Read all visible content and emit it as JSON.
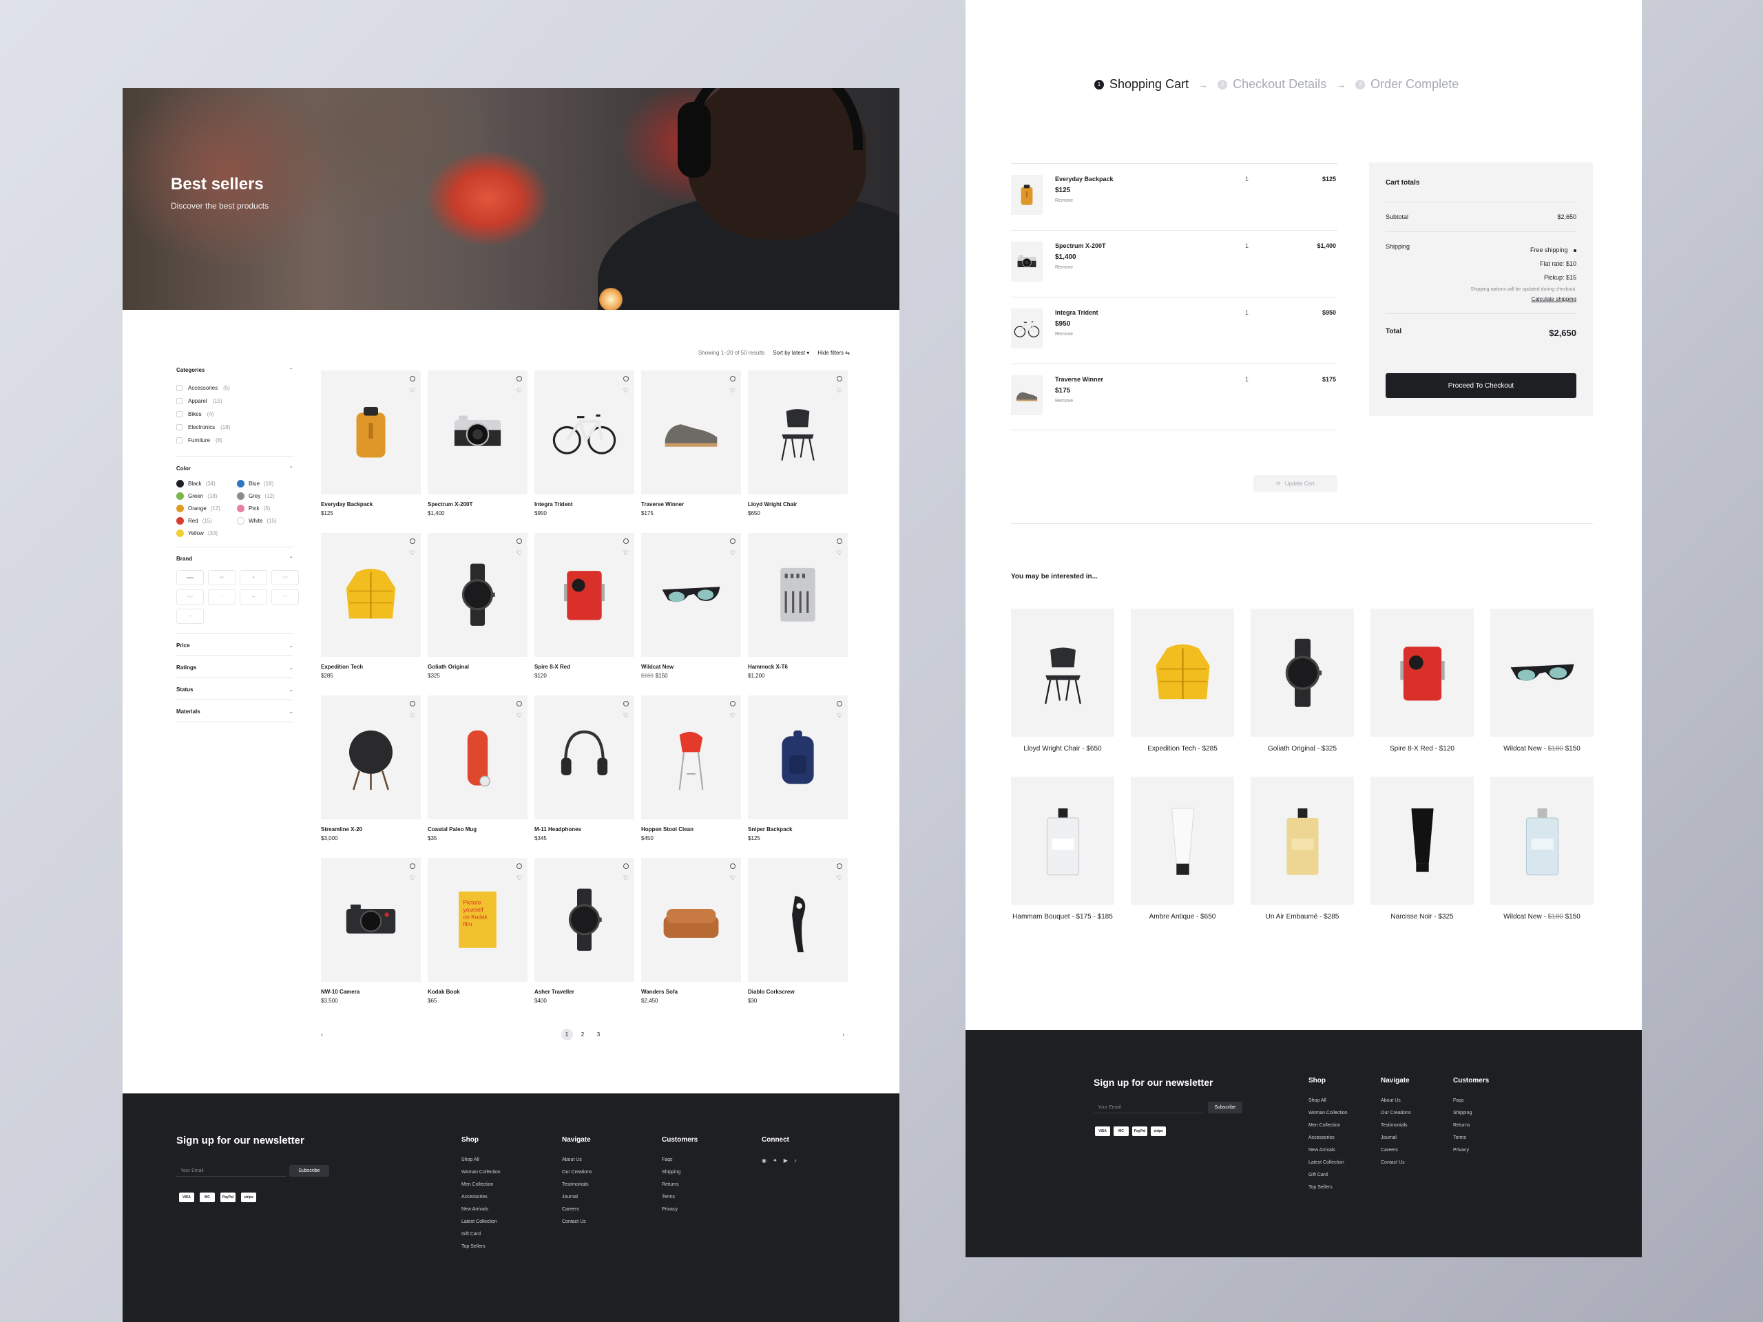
{
  "shop": {
    "hero": {
      "title": "Best sellers",
      "subtitle": "Discover the best products"
    },
    "results": {
      "showing": "Showing 1–20 of 50 results",
      "sort": "Sort by latest",
      "sort_chev": "▾",
      "hide": "Hide filters",
      "hide_icon": "⇆"
    },
    "filters": {
      "categories": {
        "title": "Categories",
        "chev": "⌃",
        "items": [
          {
            "label": "Accessories",
            "count": "(5)"
          },
          {
            "label": "Apparel",
            "count": "(15)"
          },
          {
            "label": "Bikes",
            "count": "(4)"
          },
          {
            "label": "Electronics",
            "count": "(18)"
          },
          {
            "label": "Furniture",
            "count": "(8)"
          }
        ]
      },
      "color": {
        "title": "Color",
        "chev": "⌃",
        "items": [
          {
            "label": "Black",
            "count": "(34)",
            "hex": "#1e1f22"
          },
          {
            "label": "Blue",
            "count": "(18)",
            "hex": "#2f76c4"
          },
          {
            "label": "Green",
            "count": "(18)",
            "hex": "#7ab648"
          },
          {
            "label": "Grey",
            "count": "(12)",
            "hex": "#8a8c92"
          },
          {
            "label": "Orange",
            "count": "(12)",
            "hex": "#e39a24"
          },
          {
            "label": "Pink",
            "count": "(5)",
            "hex": "#e77fa2"
          },
          {
            "label": "Red",
            "count": "(15)",
            "hex": "#d93a32"
          },
          {
            "label": "White",
            "count": "(15)",
            "hex": "#ffffff"
          },
          {
            "label": "Yellow",
            "count": "(33)",
            "hex": "#f2cd33"
          }
        ]
      },
      "brand": {
        "title": "Brand",
        "chev": "⌃"
      },
      "collapsed": [
        {
          "title": "Price",
          "chev": "⌄"
        },
        {
          "title": "Ratings",
          "chev": "⌄"
        },
        {
          "title": "Status",
          "chev": "⌄"
        },
        {
          "title": "Materials",
          "chev": "⌄"
        }
      ]
    },
    "products": [
      {
        "name": "Everyday Backpack",
        "price": "$125",
        "icon": "backpack-orange"
      },
      {
        "name": "Spectrum X-200T",
        "price": "$1,400",
        "icon": "camera"
      },
      {
        "name": "Integra Trident",
        "price": "$950",
        "icon": "bicycle"
      },
      {
        "name": "Traverse Winner",
        "price": "$175",
        "icon": "shoe"
      },
      {
        "name": "Lloyd Wright Chair",
        "price": "$650",
        "icon": "chair"
      },
      {
        "name": "Expedition Tech",
        "price": "$285",
        "icon": "jacket"
      },
      {
        "name": "Goliath Original",
        "price": "$325",
        "icon": "watch"
      },
      {
        "name": "Spire 8-X Red",
        "price": "$120",
        "icon": "radio-red"
      },
      {
        "name": "Wildcat New",
        "old": "$180",
        "price": "$150",
        "icon": "sunglasses"
      },
      {
        "name": "Hammock X-T6",
        "price": "$1,200",
        "icon": "mixer"
      },
      {
        "name": "Streamline X-20",
        "price": "$3,000",
        "icon": "speaker"
      },
      {
        "name": "Coastal Paleo Mug",
        "price": "$35",
        "icon": "mug"
      },
      {
        "name": "M-11 Headphones",
        "price": "$345",
        "icon": "headphones"
      },
      {
        "name": "Hoppen Stool Clean",
        "price": "$450",
        "icon": "stool"
      },
      {
        "name": "Sniper Backpack",
        "price": "$125",
        "icon": "backpack-blue"
      },
      {
        "name": "NW-10 Camera",
        "price": "$3,500",
        "icon": "camera-black"
      },
      {
        "name": "Kodak Book",
        "price": "$65",
        "icon": "book"
      },
      {
        "name": "Asher Traveller",
        "price": "$400",
        "icon": "watch"
      },
      {
        "name": "Wanders Sofa",
        "price": "$2,450",
        "icon": "sofa"
      },
      {
        "name": "Diablo Corkscrew",
        "price": "$30",
        "icon": "corkscrew"
      }
    ],
    "pager": {
      "prev": "‹",
      "next": "›",
      "pages": [
        "1",
        "2",
        "3"
      ],
      "active": "1"
    },
    "footer": {
      "newsletter": "Sign up for our newsletter",
      "email_placeholder": "Your Email",
      "subscribe": "Subscribe",
      "payments": [
        "VISA",
        "MC",
        "PayPal",
        "stripe"
      ],
      "shop": {
        "title": "Shop",
        "links": [
          "Shop All",
          "Woman Collection",
          "Men Collection",
          "Accessories",
          "New Arrivals",
          "Latest Collection",
          "Gift Card",
          "Top Sellers"
        ]
      },
      "navigate": {
        "title": "Navigate",
        "links": [
          "About Us",
          "Our Creations",
          "Testimonials",
          "Journal",
          "Careers",
          "Contact Us"
        ]
      },
      "customers": {
        "title": "Customers",
        "links": [
          "Faqs",
          "Shipping",
          "Returns",
          "Terms",
          "Privacy"
        ]
      },
      "connect": {
        "title": "Connect",
        "icons": [
          "◉",
          "✦",
          "▶",
          "♪"
        ]
      }
    }
  },
  "cart": {
    "steps": [
      {
        "n": "1",
        "label": "Shopping Cart"
      },
      {
        "n": "2",
        "label": "Checkout Details"
      },
      {
        "n": "3",
        "label": "Order Complete"
      }
    ],
    "arrow": "→",
    "items": [
      {
        "name": "Everyday Backpack",
        "price": "$125",
        "qty": "1",
        "total": "$125",
        "remove": "Remove",
        "icon": "backpack-orange"
      },
      {
        "name": "Spectrum X-200T",
        "price": "$1,400",
        "qty": "1",
        "total": "$1,400",
        "remove": "Remove",
        "icon": "camera"
      },
      {
        "name": "Integra Trident",
        "price": "$950",
        "qty": "1",
        "total": "$950",
        "remove": "Remove",
        "icon": "bicycle"
      },
      {
        "name": "Traverse Winner",
        "price": "$175",
        "qty": "1",
        "total": "$175",
        "remove": "Remove",
        "icon": "shoe"
      }
    ],
    "totals": {
      "title": "Cart totals",
      "subtotal_label": "Subtotal",
      "subtotal": "$2,650",
      "shipping_label": "Shipping",
      "ship_options": [
        "Free shipping",
        "Flat rate: $10",
        "Pickup: $15"
      ],
      "ship_note": "Shipping options will be updated during checkout.",
      "calc": "Calculate shipping",
      "total_label": "Total",
      "total": "$2,650",
      "checkout": "Proceed To Checkout"
    },
    "update": "Update Cart",
    "update_icon": "⟳",
    "maybe": "You may be interested in...",
    "recommend": [
      {
        "name": "Lloyd Wright Chair - $650",
        "icon": "chair"
      },
      {
        "name": "Expedition Tech - $285",
        "icon": "jacket"
      },
      {
        "name": "Goliath Original - $325",
        "icon": "watch"
      },
      {
        "name": "Spire 8-X Red - $120",
        "icon": "radio-red"
      },
      {
        "name": "Wildcat New - ",
        "old": "$180",
        "price": " $150",
        "icon": "sunglasses"
      },
      {
        "name": "Hammam Bouquet - $175 - $185",
        "icon": "bottle-clear"
      },
      {
        "name": "Ambre Antique - $650",
        "icon": "tube-white"
      },
      {
        "name": "Un Air Embaumé - $285",
        "icon": "bottle-yellow"
      },
      {
        "name": "Narcisse Noir - $325",
        "icon": "tube-black"
      },
      {
        "name": "Wildcat New - ",
        "old": "$180",
        "price": " $150",
        "icon": "bottle-blue"
      }
    ],
    "footer": {
      "newsletter": "Sign up for our newsletter",
      "email_placeholder": "Your Email",
      "subscribe": "Subscribe",
      "payments": [
        "VISA",
        "MC",
        "PayPal",
        "stripe"
      ],
      "shop": {
        "title": "Shop",
        "links": [
          "Shop All",
          "Woman Collection",
          "Men Collection",
          "Accessories",
          "New Arrivals",
          "Latest Collection",
          "Gift Card",
          "Top Sellers"
        ]
      },
      "navigate": {
        "title": "Navigate",
        "links": [
          "About Us",
          "Our Creations",
          "Testimonials",
          "Journal",
          "Careers",
          "Contact Us"
        ]
      },
      "customers": {
        "title": "Customers",
        "links": [
          "Faqs",
          "Shipping",
          "Returns",
          "Terms",
          "Privacy"
        ]
      }
    }
  }
}
